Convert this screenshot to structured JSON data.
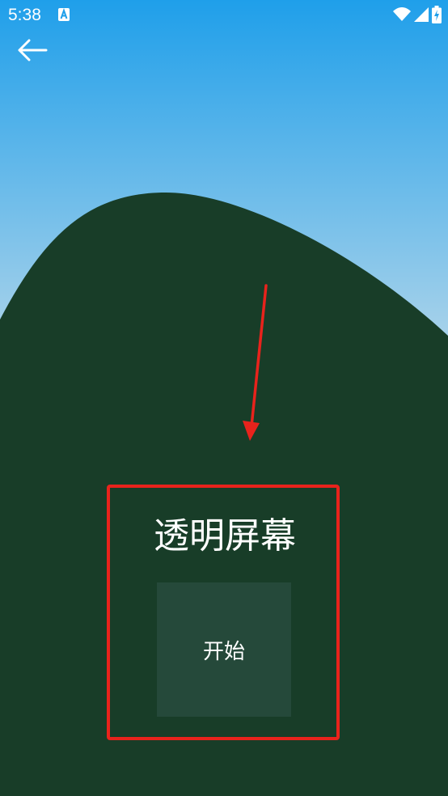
{
  "status_bar": {
    "time": "5:38",
    "notification_icon": "a-letter-notification-icon",
    "wifi_icon": "wifi-icon",
    "signal_icon": "cell-signal-icon",
    "battery_icon": "battery-charging-icon"
  },
  "toolbar": {
    "back_icon": "arrow-left-icon"
  },
  "main": {
    "title": "透明屏幕",
    "start_label": "开始"
  },
  "colors": {
    "sky_top": "#1f9fea",
    "sky_bottom": "#a8d2ea",
    "hill": "#183d28",
    "button_bg": "#25493a",
    "annotation": "#e8231c"
  }
}
